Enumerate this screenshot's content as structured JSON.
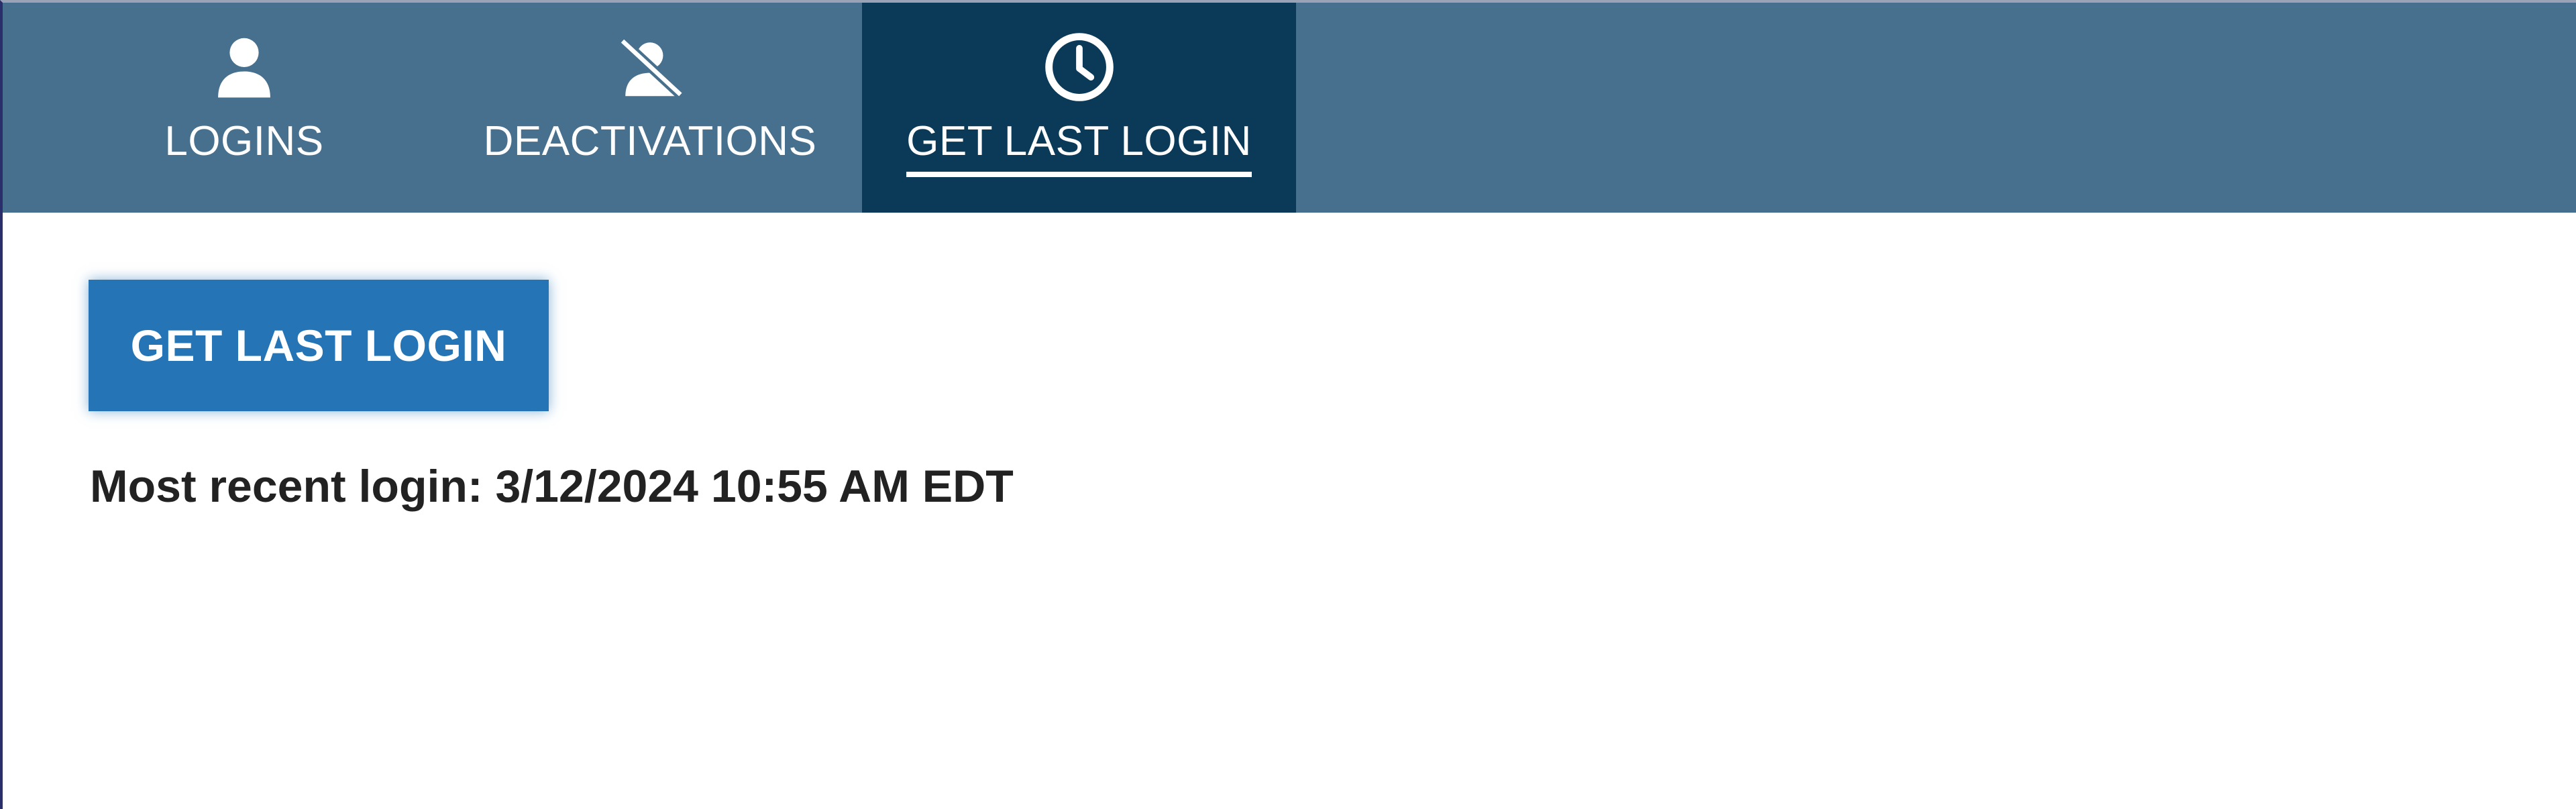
{
  "tabs": [
    {
      "label": "LOGINS",
      "icon": "user-icon",
      "active": false
    },
    {
      "label": "DEACTIVATIONS",
      "icon": "user-slash-icon",
      "active": false
    },
    {
      "label": "GET LAST LOGIN",
      "icon": "clock-icon",
      "active": true
    }
  ],
  "main": {
    "button_label": "GET LAST LOGIN",
    "result_text": "Most recent login: 3/12/2024 10:55 AM EDT"
  },
  "colors": {
    "tabbar": "#47708e",
    "active_tab": "#0b3a58",
    "button": "#2575b6",
    "text": "#222222"
  }
}
